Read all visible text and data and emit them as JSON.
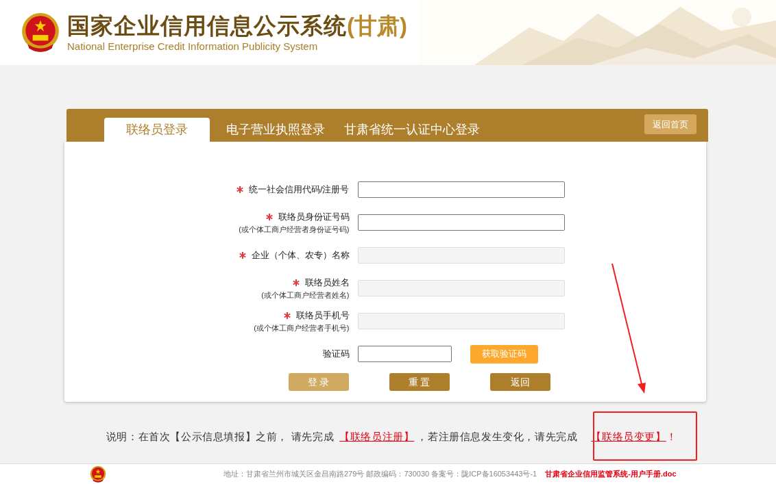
{
  "header": {
    "title": "国家企业信用信息公示系统",
    "region": "(甘肃)",
    "subtitle": "National Enterprise Credit Information Publicity System"
  },
  "tabs": [
    {
      "label": "联络员登录",
      "selected": true
    },
    {
      "label": "电子营业执照登录",
      "selected": false
    },
    {
      "label": "甘肃省统一认证中心登录",
      "selected": false
    }
  ],
  "home_button": "返回首页",
  "fields": [
    {
      "label": "统一社会信用代码/注册号",
      "required": true,
      "disabled": false
    },
    {
      "label": "联络员身份证号码",
      "note": "(或个体工商户经营者身份证号码)",
      "required": true,
      "disabled": false
    },
    {
      "label": "企业（个体、农专）名称",
      "required": true,
      "disabled": true
    },
    {
      "label": "联络员姓名",
      "note": "(或个体工商户经营者姓名)",
      "required": true,
      "disabled": true
    },
    {
      "label": "联络员手机号",
      "note": "(或个体工商户经营者手机号)",
      "required": true,
      "disabled": true
    }
  ],
  "captcha": {
    "label": "验证码",
    "button": "获取验证码"
  },
  "buttons": [
    {
      "label": "登 录",
      "kind": "primary"
    },
    {
      "label": "重 置",
      "kind": "secondary"
    },
    {
      "label": "返回",
      "kind": "secondary"
    }
  ],
  "notice": {
    "text": "说明：在首次【公示信息填报】之前， 请先完成",
    "link1": "【联络员注册】",
    "middle": "，若注册信息发生变化，请先完成",
    "link2": "【联络员变更】",
    "end": "！"
  },
  "footer": {
    "address": "地址：甘肃省兰州市城关区金昌南路279号 邮政编码：730030 备案号：陇ICP备16053443号-1",
    "manual": "甘肃省企业信用监管系统-用户手册.doc"
  }
}
